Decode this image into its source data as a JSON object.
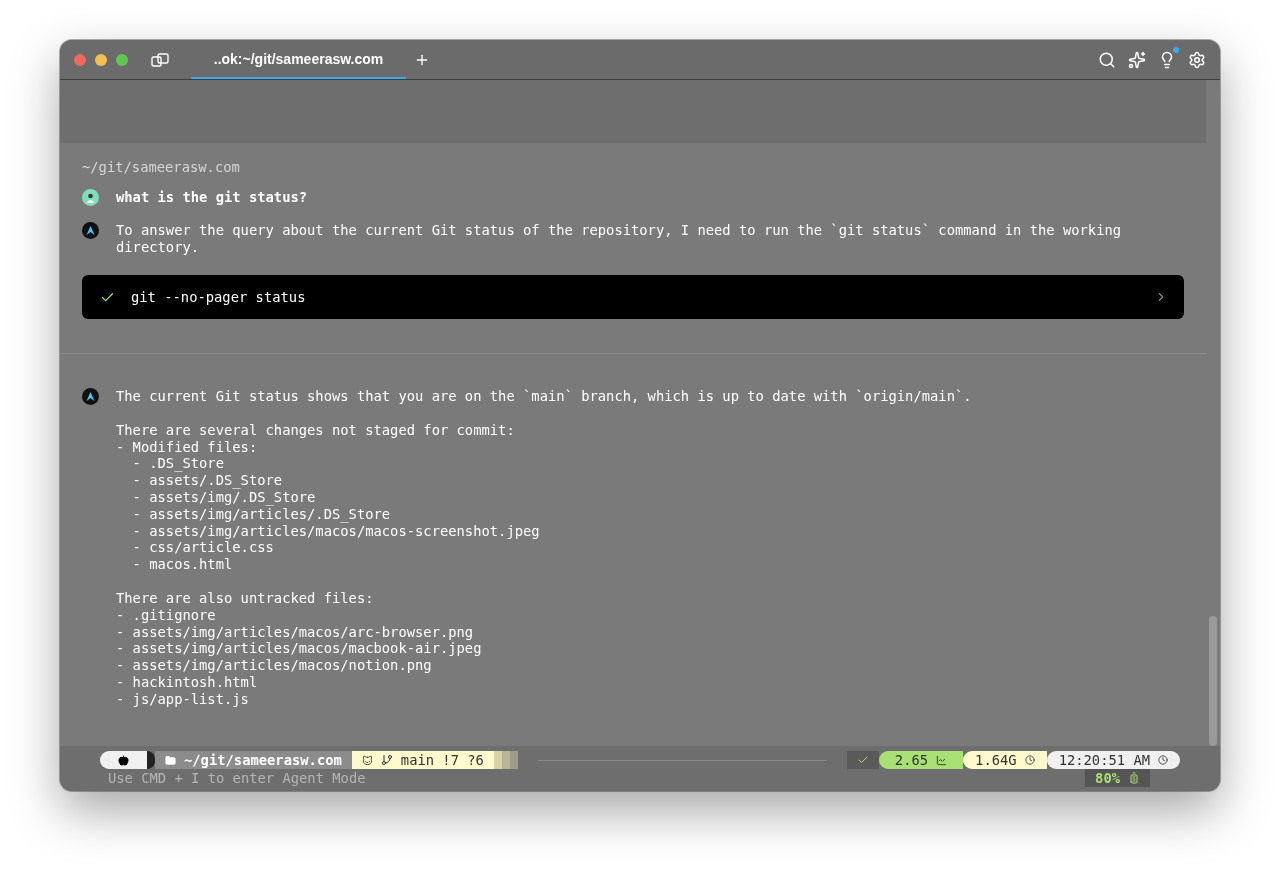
{
  "tab": {
    "title": "..ok:~/git/sameerasw.com",
    "selected": true
  },
  "toolbar": {
    "notification": true
  },
  "block": {
    "path": "~/git/sameerasw.com",
    "query": "what is the git status?",
    "reply": "To answer the query about the current Git status of the repository, I need to run the `git status` command in the working directory.",
    "command": {
      "text": "git --no-pager status",
      "succeeded": true
    }
  },
  "response": {
    "paragraphs": [
      [
        "The current Git status shows that you are on the `main` branch, which is up to date with `origin/main`."
      ],
      [
        "There are several changes not staged for commit:",
        "- Modified files:",
        "  - .DS_Store",
        "  - assets/.DS_Store",
        "  - assets/img/.DS_Store",
        "  - assets/img/articles/.DS_Store",
        "  - assets/img/articles/macos/macos-screenshot.jpeg",
        "  - css/article.css",
        "  - macos.html"
      ],
      [
        "There are also untracked files:",
        "- .gitignore",
        "- assets/img/articles/macos/arc-browser.png",
        "- assets/img/articles/macos/macbook-air.jpeg",
        "- assets/img/articles/macos/notion.png",
        "- hackintosh.html",
        "- js/app-list.js"
      ]
    ]
  },
  "prompt": {
    "path": "~/git/sameerasw.com",
    "git": "main !7 ?6",
    "load": "2.65",
    "memory": "1.64G",
    "time": "12:20:51 AM",
    "battery": "80%",
    "placeholder": "Use CMD + I to enter Agent Mode"
  }
}
